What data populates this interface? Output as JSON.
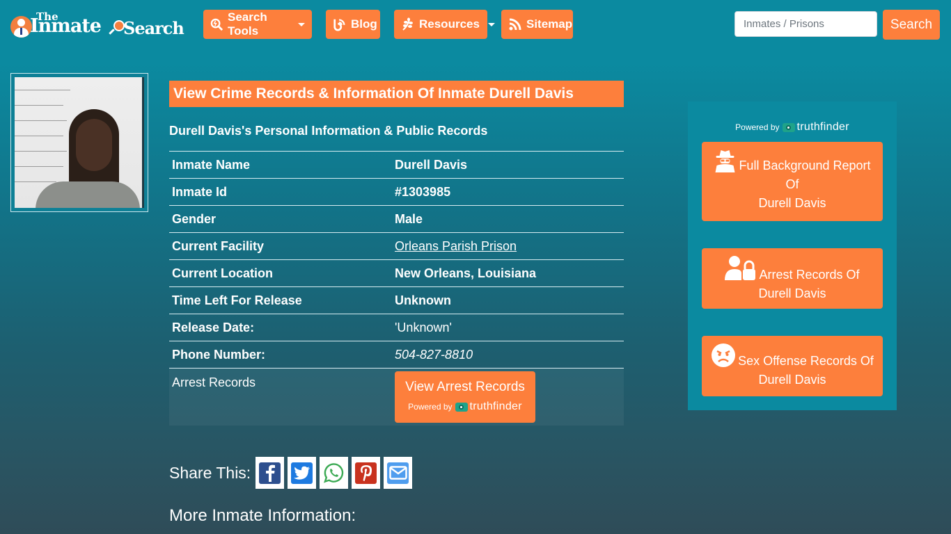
{
  "brand": {
    "the": "The",
    "inmate": "Inmate",
    "search": "Search",
    "accent": "#fd7f3c",
    "header_bg": "#0b8aa0"
  },
  "nav": [
    {
      "label": "Search Tools",
      "icon": "search-tools-icon",
      "dropdown": true
    },
    {
      "label": "Blog",
      "icon": "blog-icon",
      "dropdown": false
    },
    {
      "label": "Resources",
      "icon": "leaf-icon",
      "dropdown": true
    },
    {
      "label": "Sitemap",
      "icon": "rss-icon",
      "dropdown": false
    }
  ],
  "search": {
    "placeholder": "Inmates / Prisons",
    "value": "",
    "button": "Search"
  },
  "main": {
    "title": "View Crime Records & Information Of Inmate Durell Davis",
    "subtitle": "Durell Davis's Personal Information & Public Records",
    "rows": [
      {
        "label": "Inmate Name",
        "value": "Durell Davis"
      },
      {
        "label": "Inmate Id",
        "value": "#1303985"
      },
      {
        "label": "Gender",
        "value": "Male"
      },
      {
        "label": "Current Facility",
        "value": "Orleans Parish Prison"
      },
      {
        "label": "Current Location",
        "value": "New Orleans, Louisiana"
      },
      {
        "label": "Time Left For Release",
        "value": "Unknown"
      },
      {
        "label": "Release Date:",
        "value": "'Unknown'"
      },
      {
        "label": "Phone Number:",
        "value": "504-827-8810"
      }
    ],
    "arrest": {
      "label": "Arrest Records",
      "button": "View Arrest Records",
      "powered_by": "Powered by",
      "provider": "truthfinder"
    }
  },
  "sidebar": {
    "powered_by": "Powered by",
    "provider": "truthfinder",
    "buttons": [
      {
        "line1": "Full Background Report",
        "line2": "Of",
        "line3": "Durell Davis",
        "icon": "spy-icon"
      },
      {
        "line1": "Arrest Records Of",
        "line2": "Durell Davis",
        "icon": "user-lock-icon"
      },
      {
        "line1": "Sex Offense Records Of",
        "line2": "Durell Davis",
        "icon": "angry-face-icon"
      }
    ]
  },
  "share": {
    "label": "Share This:",
    "networks": [
      "facebook",
      "twitter",
      "whatsapp",
      "pinterest",
      "email"
    ]
  },
  "more": {
    "label": "More Inmate Information:"
  }
}
